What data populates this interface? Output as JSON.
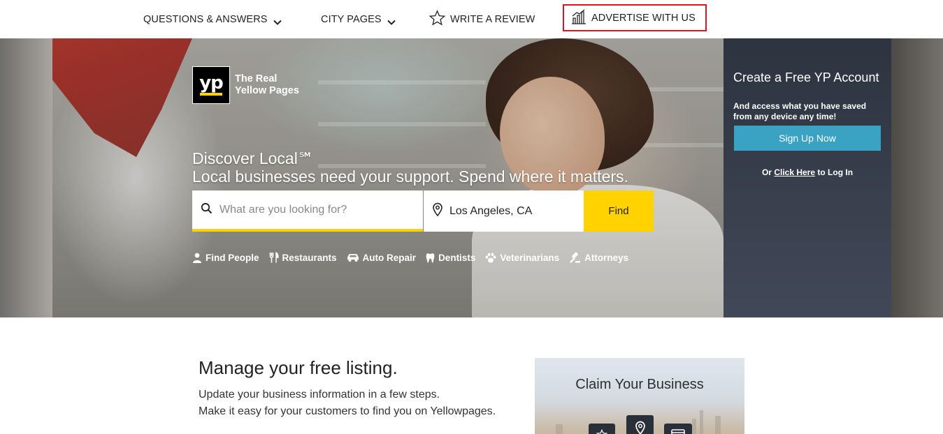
{
  "nav": {
    "questions_answers": "QUESTIONS & ANSWERS",
    "city_pages": "CITY PAGES",
    "write_review": "WRITE A REVIEW",
    "advertise": "ADVERTISE WITH US"
  },
  "logo": {
    "mark": "yp",
    "tagline_line1": "The Real",
    "tagline_line2": "Yellow Pages"
  },
  "hero": {
    "headline_line1": "Discover Local℠",
    "headline_line2": "Local businesses need your support. Spend where it matters."
  },
  "search": {
    "what_placeholder": "What are you looking for?",
    "where_value": "Los Angeles, CA",
    "find_label": "Find"
  },
  "quick_links": [
    {
      "label": "Find People",
      "icon": "person-icon"
    },
    {
      "label": "Restaurants",
      "icon": "fork-knife-icon"
    },
    {
      "label": "Auto Repair",
      "icon": "car-icon"
    },
    {
      "label": "Dentists",
      "icon": "tooth-icon"
    },
    {
      "label": "Veterinarians",
      "icon": "paw-icon"
    },
    {
      "label": "Attorneys",
      "icon": "gavel-icon"
    }
  ],
  "signup": {
    "title": "Create a Free YP Account",
    "text": "And access what you have saved from any device any time!",
    "button": "Sign Up Now",
    "login_prefix": "Or",
    "login_link": "Click Here",
    "login_suffix": "to Log In"
  },
  "manage": {
    "title": "Manage your free listing.",
    "line1": "Update your business information in a few steps.",
    "line2": "Make it easy for your customers to find you on Yellowpages."
  },
  "claim": {
    "title": "Claim Your Business"
  },
  "colors": {
    "brand_yellow": "#ffd200",
    "signup_blue": "#3aa3c4",
    "highlight_red": "#e0141e"
  }
}
